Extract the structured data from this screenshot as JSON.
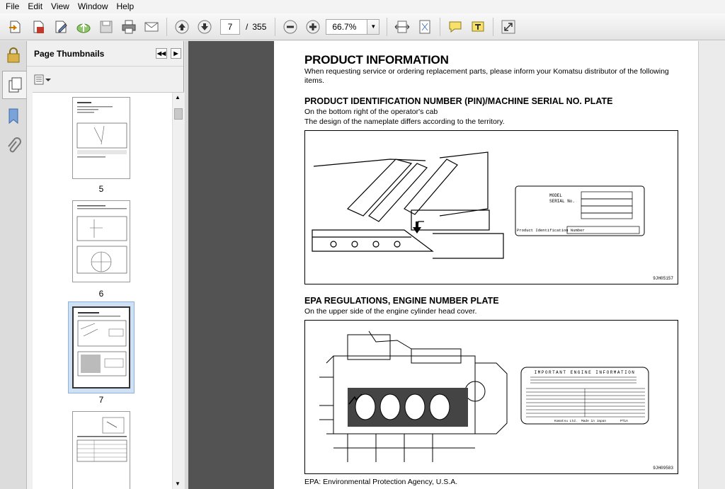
{
  "menu": [
    "File",
    "Edit",
    "View",
    "Window",
    "Help"
  ],
  "toolbar": {
    "page_current": "7",
    "page_sep": "/",
    "page_total": "355",
    "zoom": "66.7%"
  },
  "panel": {
    "title": "Page Thumbnails",
    "thumbnails": [
      {
        "label": "5"
      },
      {
        "label": "6"
      },
      {
        "label": "7"
      },
      {
        "label": ""
      }
    ]
  },
  "document": {
    "title": "PRODUCT INFORMATION",
    "intro": "When requesting service or ordering replacement parts, please inform your Komatsu distributor of the following items.",
    "section1": {
      "heading": "PRODUCT IDENTIFICATION NUMBER (PIN)/MACHINE SERIAL NO. PLATE",
      "line1": "On the bottom right of the operator's cab",
      "line2": "The design of the nameplate differs according to the territory.",
      "plate_model": "MODEL",
      "plate_serial": "SERIAL No.",
      "plate_pin": "Product Identification Number",
      "fig_id": "9JH05157"
    },
    "section2": {
      "heading": "EPA REGULATIONS, ENGINE NUMBER PLATE",
      "line1": "On the upper side of the engine cylinder head cover.",
      "plate_title": "IMPORTANT ENGINE INFORMATION",
      "plate_footer_left": "Komatsu Ltd.",
      "plate_footer_mid": "Made in Japan",
      "plate_footer_right": "PT1A",
      "fig_id": "9JH09583"
    },
    "footnote": "EPA: Environmental Protection Agency, U.S.A."
  }
}
